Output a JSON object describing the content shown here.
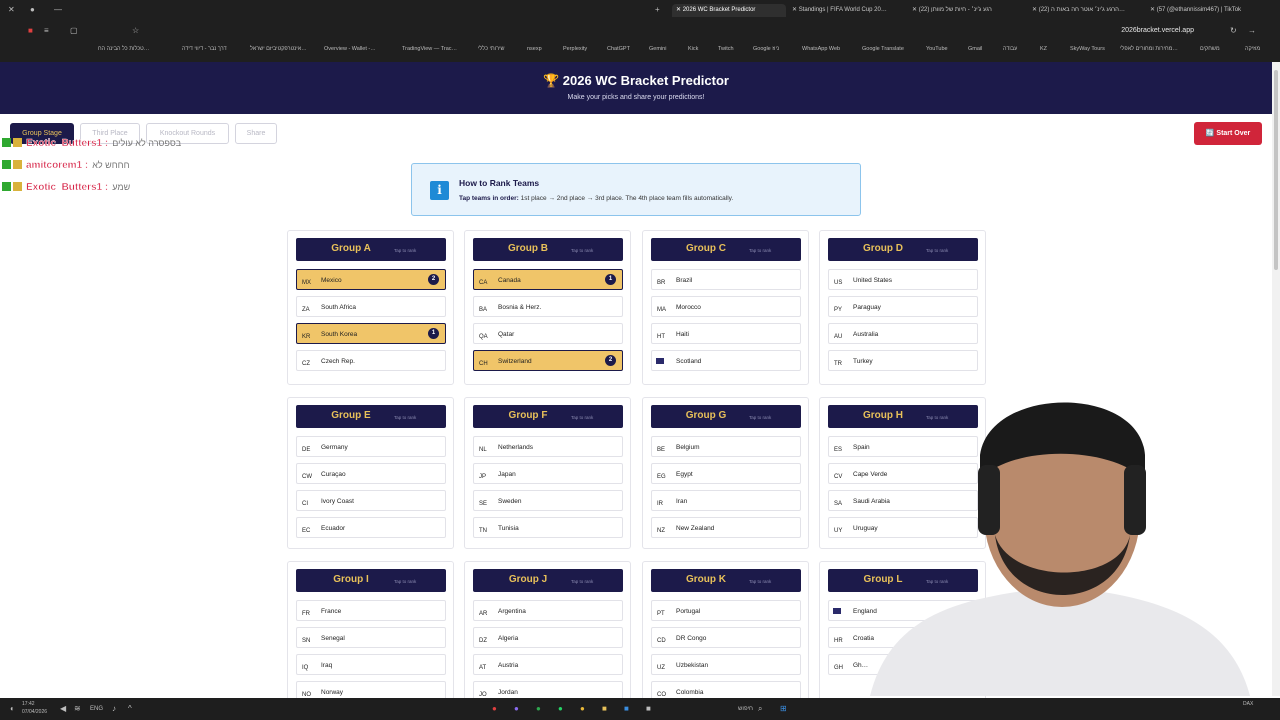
{
  "browser": {
    "tabs": [
      "2026 WC Bracket Predictor",
      "Standings | FIFA World Cup 20…",
      "(22) רגע ג'ינ׳ - חיות של מוותן",
      "(22) הרגע ג'ינ׳ אוטר חה באות ה…",
      "(57 (@ethannissim467) | TikTok"
    ],
    "url": "2026bracket.vercel.app",
    "bookmarks": [
      "טכלות כל הבינה הח…",
      "דרך נבר - דיווי דידה",
      "אינטרפקטיביזם ישראל…",
      "Overview - Wallet -…",
      "TradingView — Trac…",
      "שירותי כללי",
      "nsexp",
      "Perplexity",
      "ChatGPT",
      "Gemini",
      "Kick",
      "Twitch",
      "Google ניוז",
      "WhatsApp Web",
      "Google Translate",
      "YouTube",
      "Gmail",
      "עבודה",
      "KZ",
      "SkyWay Tours",
      "מחירות ומחורים לאפלי…",
      "משחקים",
      "מוזיקה"
    ]
  },
  "header": {
    "title": "🏆 2026 WC Bracket Predictor",
    "subtitle": "Make your picks and share your predictions!"
  },
  "nav": {
    "tabs": [
      "Group Stage",
      "Third Place",
      "Knockout Rounds",
      "Share"
    ],
    "start_over": "🔄 Start Over"
  },
  "chat": [
    {
      "name": "Exotic_Butters1 :",
      "msg": "בספסרה לא עולים"
    },
    {
      "name": "amitcorem1 :",
      "msg": "חחחש לא"
    },
    {
      "name": "Exotic_Butters1 :",
      "msg": "שמע"
    }
  ],
  "howto": {
    "title": "How to Rank Teams",
    "lead": "Tap teams in order:",
    "text": " 1st place → 2nd place → 3rd place. The 4th place team fills automatically."
  },
  "group_hint": "Tap to rank",
  "groups": [
    {
      "name": "Group A",
      "teams": [
        {
          "code": "MX",
          "name": "Mexico",
          "rank": "2"
        },
        {
          "code": "ZA",
          "name": "South Africa",
          "rank": ""
        },
        {
          "code": "KR",
          "name": "South Korea",
          "rank": "1"
        },
        {
          "code": "CZ",
          "name": "Czech Rep.",
          "rank": ""
        }
      ]
    },
    {
      "name": "Group B",
      "teams": [
        {
          "code": "CA",
          "name": "Canada",
          "rank": "1"
        },
        {
          "code": "BA",
          "name": "Bosnia & Herz.",
          "rank": ""
        },
        {
          "code": "QA",
          "name": "Qatar",
          "rank": ""
        },
        {
          "code": "CH",
          "name": "Switzerland",
          "rank": "2"
        }
      ]
    },
    {
      "name": "Group C",
      "teams": [
        {
          "code": "BR",
          "name": "Brazil",
          "rank": ""
        },
        {
          "code": "MA",
          "name": "Morocco",
          "rank": ""
        },
        {
          "code": "HT",
          "name": "Haiti",
          "rank": ""
        },
        {
          "code": "",
          "name": "Scotland",
          "rank": ""
        }
      ]
    },
    {
      "name": "Group D",
      "teams": [
        {
          "code": "US",
          "name": "United States",
          "rank": ""
        },
        {
          "code": "PY",
          "name": "Paraguay",
          "rank": ""
        },
        {
          "code": "AU",
          "name": "Australia",
          "rank": ""
        },
        {
          "code": "TR",
          "name": "Turkey",
          "rank": ""
        }
      ]
    },
    {
      "name": "Group E",
      "teams": [
        {
          "code": "DE",
          "name": "Germany",
          "rank": ""
        },
        {
          "code": "CW",
          "name": "Curaçao",
          "rank": ""
        },
        {
          "code": "CI",
          "name": "Ivory Coast",
          "rank": ""
        },
        {
          "code": "EC",
          "name": "Ecuador",
          "rank": ""
        }
      ]
    },
    {
      "name": "Group F",
      "teams": [
        {
          "code": "NL",
          "name": "Netherlands",
          "rank": ""
        },
        {
          "code": "JP",
          "name": "Japan",
          "rank": ""
        },
        {
          "code": "SE",
          "name": "Sweden",
          "rank": ""
        },
        {
          "code": "TN",
          "name": "Tunisia",
          "rank": ""
        }
      ]
    },
    {
      "name": "Group G",
      "teams": [
        {
          "code": "BE",
          "name": "Belgium",
          "rank": ""
        },
        {
          "code": "EG",
          "name": "Egypt",
          "rank": ""
        },
        {
          "code": "IR",
          "name": "Iran",
          "rank": ""
        },
        {
          "code": "NZ",
          "name": "New Zealand",
          "rank": ""
        }
      ]
    },
    {
      "name": "Group H",
      "teams": [
        {
          "code": "ES",
          "name": "Spain",
          "rank": ""
        },
        {
          "code": "CV",
          "name": "Cape Verde",
          "rank": ""
        },
        {
          "code": "SA",
          "name": "Saudi Arabia",
          "rank": ""
        },
        {
          "code": "UY",
          "name": "Uruguay",
          "rank": ""
        }
      ]
    },
    {
      "name": "Group I",
      "teams": [
        {
          "code": "FR",
          "name": "France",
          "rank": ""
        },
        {
          "code": "SN",
          "name": "Senegal",
          "rank": ""
        },
        {
          "code": "IQ",
          "name": "Iraq",
          "rank": ""
        },
        {
          "code": "NO",
          "name": "Norway",
          "rank": ""
        }
      ]
    },
    {
      "name": "Group J",
      "teams": [
        {
          "code": "AR",
          "name": "Argentina",
          "rank": ""
        },
        {
          "code": "DZ",
          "name": "Algeria",
          "rank": ""
        },
        {
          "code": "AT",
          "name": "Austria",
          "rank": ""
        },
        {
          "code": "JO",
          "name": "Jordan",
          "rank": ""
        }
      ]
    },
    {
      "name": "Group K",
      "teams": [
        {
          "code": "PT",
          "name": "Portugal",
          "rank": ""
        },
        {
          "code": "CD",
          "name": "DR Congo",
          "rank": ""
        },
        {
          "code": "UZ",
          "name": "Uzbekistan",
          "rank": ""
        },
        {
          "code": "CO",
          "name": "Colombia",
          "rank": ""
        }
      ]
    },
    {
      "name": "Group L",
      "teams": [
        {
          "code": "",
          "name": "England",
          "rank": ""
        },
        {
          "code": "HR",
          "name": "Croatia",
          "rank": ""
        },
        {
          "code": "GH",
          "name": "Gh…",
          "rank": ""
        },
        {
          "code": "",
          "name": "",
          "rank": ""
        }
      ]
    }
  ],
  "taskbar": {
    "time": "17:42",
    "date": "07/04/2026",
    "lang": "ENG",
    "search": "חיפוש",
    "ticker": "DAX"
  },
  "colors": {
    "navy": "#1c1a4a",
    "gold": "#e8c15a",
    "selected": "#f0c569",
    "danger": "#d0253a"
  }
}
